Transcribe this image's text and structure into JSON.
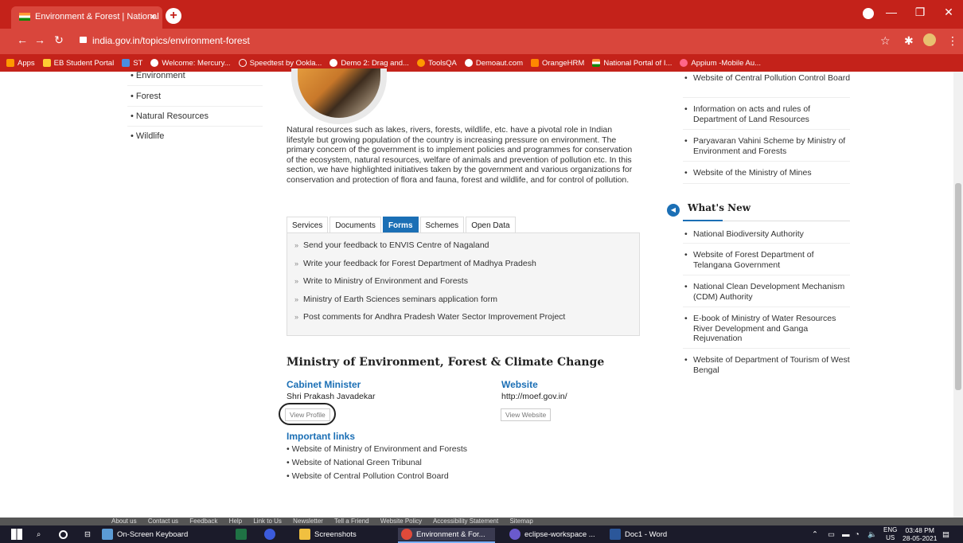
{
  "browser": {
    "tab_title": "Environment & Forest | National",
    "tab_close": "×",
    "new_tab": "+",
    "url": "india.gov.in/topics/environment-forest",
    "window_buttons": [
      "—",
      "❐",
      "✕"
    ]
  },
  "bookmarks": [
    {
      "label": "Apps",
      "color": "#ff9900"
    },
    {
      "label": "EB Student Portal",
      "color": "#ffcc33"
    },
    {
      "label": "ST",
      "color": "#4a8de0"
    },
    {
      "label": "Welcome: Mercury...",
      "color": "#ffffff"
    },
    {
      "label": "Speedtest by Ookla...",
      "color": "#ffffff"
    },
    {
      "label": "Demo 2: Drag and...",
      "color": "#ffffff"
    },
    {
      "label": "ToolsQA",
      "color": "#ff9900"
    },
    {
      "label": "Demoaut.com",
      "color": "#ffffff"
    },
    {
      "label": "OrangeHRM",
      "color": "#ff8800"
    },
    {
      "label": "National Portal of I...",
      "color": "#ff9933"
    },
    {
      "label": "Appium -Mobile Au...",
      "color": "#ff6688"
    }
  ],
  "left_nav": [
    "Environment",
    "Forest",
    "Natural Resources",
    "Wildlife"
  ],
  "intro_text": "Natural resources such as lakes, rivers, forests, wildlife, etc. have a pivotal role in Indian lifestyle but growing population of the country is increasing pressure on environment. The primary concern of the government is to implement policies and programmes for conservation of the ecosystem, natural resources, welfare of animals and prevention of pollution etc. In this section, we have highlighted initiatives taken by the government and various organizations for conservation and protection of flora and fauna, forest and wildlife, and for control of pollution.",
  "tabs": [
    {
      "label": "Services",
      "active": false
    },
    {
      "label": "Documents",
      "active": false
    },
    {
      "label": "Forms",
      "active": true
    },
    {
      "label": "Schemes",
      "active": false
    },
    {
      "label": "Open Data",
      "active": false
    }
  ],
  "tab_arrow": "»",
  "form_links": [
    "Send your feedback to ENVIS Centre of Nagaland",
    "Write your feedback for Forest Department of Madhya Pradesh",
    "Write to Ministry of Environment and Forests",
    "Ministry of Earth Sciences seminars application form",
    "Post comments for Andhra Pradesh Water Sector Improvement Project"
  ],
  "ministry": {
    "title": "Ministry of Environment, Forest & Climate Change",
    "minister_heading": "Cabinet Minister",
    "minister_name": "Shri Prakash Javadekar",
    "view_profile": "View Profile",
    "website_heading": "Website",
    "website_url": "http://moef.gov.in/",
    "view_website": "View Website",
    "important_links_heading": "Important links",
    "important_links": [
      "Website of Ministry of Environment and Forests",
      "Website of National Green Tribunal",
      "Website of Central Pollution Control Board"
    ]
  },
  "right_links": [
    "Website of Central Pollution Control Board",
    "Information on acts and rules of Department of Land Resources",
    "Paryavaran Vahini Scheme by Ministry of Environment and Forests",
    "Website of the Ministry of Mines"
  ],
  "whats_new": {
    "heading": "What's New",
    "items": [
      "National Biodiversity Authority",
      "Website of Forest Department of Telangana Government",
      "National Clean Development Mechanism (CDM) Authority",
      "E-book of Ministry of Water Resources River Development and Ganga Rejuvenation",
      "Website of Department of Tourism of West Bengal"
    ]
  },
  "footer_links": [
    "About us",
    "Contact us",
    "Feedback",
    "Help",
    "Link to Us",
    "Newsletter",
    "Tell a Friend",
    "Website Policy",
    "Accessibility Statement",
    "Sitemap"
  ],
  "taskbar": {
    "items": [
      {
        "label": "On-Screen Keyboard",
        "color": "#5b9bd5"
      },
      {
        "label": "",
        "color": "#1f7244"
      },
      {
        "label": "",
        "color": "#3b5bdb"
      },
      {
        "label": "Screenshots",
        "color": "#f0c040"
      },
      {
        "label": "Environment & For...",
        "color": "#e04a3a"
      },
      {
        "label": "eclipse-workspace ...",
        "color": "#6a5acd"
      },
      {
        "label": "Doc1 - Word",
        "color": "#2b579a"
      }
    ],
    "tray_lang_top": "ENG",
    "tray_lang_bottom": "US",
    "time": "03:48 PM",
    "date": "28-05-2021"
  }
}
